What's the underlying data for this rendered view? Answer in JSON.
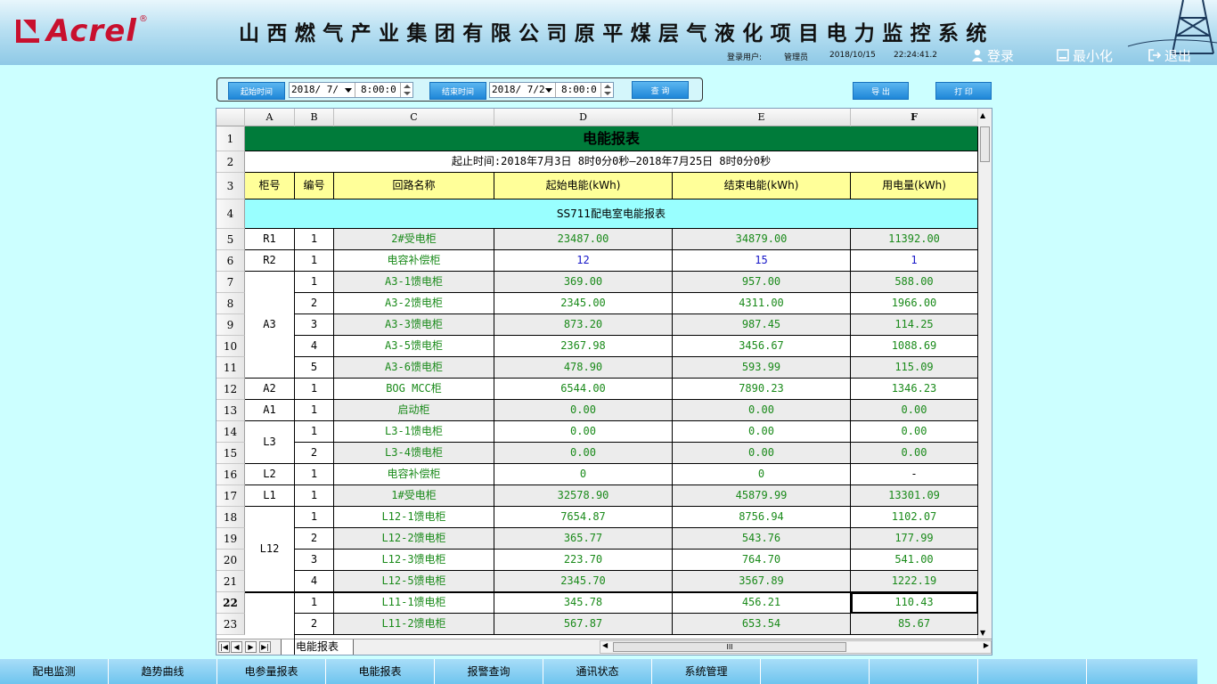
{
  "header": {
    "logo_text": "Acrel",
    "logo_reg": "®",
    "system_title": "山西燃气产业集团有限公司原平煤层气液化项目电力监控系统",
    "login_user_label": "登录用户:",
    "login_user": "管理员",
    "date": "2018/10/15",
    "time": "22:24:41.2",
    "login_label": "登录",
    "minimize_label": "最小化",
    "exit_label": "退出"
  },
  "toolbar": {
    "start_label": "起始时间",
    "start_date": "2018/ 7/",
    "start_time": "8:00:0",
    "end_label": "结束时间",
    "end_date": "2018/ 7/2",
    "end_time": "8:00:0",
    "query_label": "查 询",
    "export_label": "导 出",
    "print_label": "打 印"
  },
  "sheet": {
    "columns": [
      "A",
      "B",
      "C",
      "D",
      "E",
      "F"
    ],
    "title": "电能报表",
    "period": "起止时间:2018年7月3日 8时0分0秒—2018年7月25日 8时0分0秒",
    "headers": [
      "柜号",
      "编号",
      "回路名称",
      "起始电能(kWh)",
      "结束电能(kWh)",
      "用电量(kWh)"
    ],
    "section": "SS711配电室电能报表",
    "row_numbers": [
      "1",
      "2",
      "3",
      "4",
      "5",
      "6",
      "7",
      "8",
      "9",
      "10",
      "11",
      "12",
      "13",
      "14",
      "15",
      "16",
      "17",
      "18",
      "19",
      "20",
      "21",
      "22",
      "23"
    ],
    "groups": [
      {
        "cab": "R1",
        "rows": [
          [
            "1",
            "2#受电柜",
            "23487.00",
            "34879.00",
            "11392.00"
          ]
        ]
      },
      {
        "cab": "R2",
        "rows": [
          [
            "1",
            "电容补偿柜",
            "12",
            "15",
            "1"
          ]
        ]
      },
      {
        "cab": "A3",
        "rows": [
          [
            "1",
            "A3-1馈电柜",
            "369.00",
            "957.00",
            "588.00"
          ],
          [
            "2",
            "A3-2馈电柜",
            "2345.00",
            "4311.00",
            "1966.00"
          ],
          [
            "3",
            "A3-3馈电柜",
            "873.20",
            "987.45",
            "114.25"
          ],
          [
            "4",
            "A3-5馈电柜",
            "2367.98",
            "3456.67",
            "1088.69"
          ],
          [
            "5",
            "A3-6馈电柜",
            "478.90",
            "593.99",
            "115.09"
          ]
        ]
      },
      {
        "cab": "A2",
        "rows": [
          [
            "1",
            "BOG MCC柜",
            "6544.00",
            "7890.23",
            "1346.23"
          ]
        ]
      },
      {
        "cab": "A1",
        "rows": [
          [
            "1",
            "启动柜",
            "0.00",
            "0.00",
            "0.00"
          ]
        ]
      },
      {
        "cab": "L3",
        "rows": [
          [
            "1",
            "L3-1馈电柜",
            "0.00",
            "0.00",
            "0.00"
          ],
          [
            "2",
            "L3-4馈电柜",
            "0.00",
            "0.00",
            "0.00"
          ]
        ]
      },
      {
        "cab": "L2",
        "rows": [
          [
            "1",
            "电容补偿柜",
            "0",
            "0",
            "-"
          ]
        ]
      },
      {
        "cab": "L1",
        "rows": [
          [
            "1",
            "1#受电柜",
            "32578.90",
            "45879.99",
            "13301.09"
          ]
        ]
      },
      {
        "cab": "L12",
        "rows": [
          [
            "1",
            "L12-1馈电柜",
            "7654.87",
            "8756.94",
            "1102.07"
          ],
          [
            "2",
            "L12-2馈电柜",
            "365.77",
            "543.76",
            "177.99"
          ],
          [
            "3",
            "L12-3馈电柜",
            "223.70",
            "764.70",
            "541.00"
          ],
          [
            "4",
            "L12-5馈电柜",
            "2345.70",
            "3567.89",
            "1222.19"
          ]
        ]
      },
      {
        "cab": "",
        "rows": [
          [
            "1",
            "L11-1馈电柜",
            "345.78",
            "456.21",
            "110.43"
          ],
          [
            "2",
            "L11-2馈电柜",
            "567.87",
            "653.54",
            "85.67"
          ]
        ]
      }
    ],
    "sheet_tab": "电能报表",
    "hscroll_grip": "III",
    "nav_first": "|◀",
    "nav_prev": "◀",
    "nav_next": "▶",
    "nav_last": "▶|",
    "scroll_up": "▲",
    "scroll_down": "▼",
    "scroll_left": "◀",
    "scroll_right": "▶"
  },
  "nav": [
    "配电监测",
    "趋势曲线",
    "电参量报表",
    "电能报表",
    "报警查询",
    "通讯状态",
    "系统管理",
    "",
    "",
    "",
    ""
  ],
  "colors": {
    "brand_red": "#c8102e",
    "title_green": "#007b3a",
    "header_yellow": "#ffff99",
    "section_cyan": "#99ffff",
    "value_green": "#1a8a1a",
    "nav_blue": "#6ec4ee"
  }
}
